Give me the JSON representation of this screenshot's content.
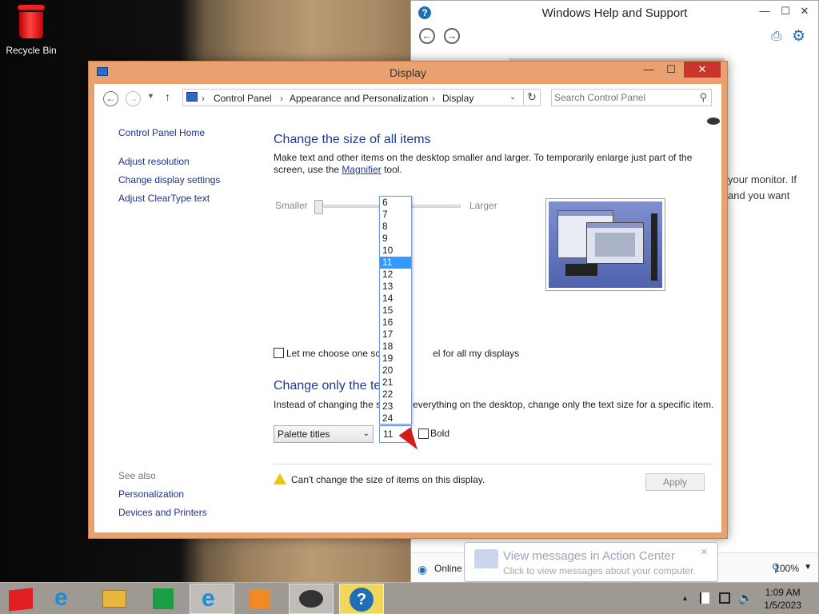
{
  "desktop": {
    "recycle_bin_label": "Recycle Bin"
  },
  "help_window": {
    "title": "Windows Help and Support",
    "body_text_line1": "your monitor. If",
    "body_text_line2": "and you want",
    "online_help_label": "Online Help",
    "zoom_label": "100%"
  },
  "display_window": {
    "title": "Display",
    "breadcrumb": [
      "Control Panel",
      "Appearance and Personalization",
      "Display"
    ],
    "search_placeholder": "Search Control Panel",
    "sidebar": {
      "home": "Control Panel Home",
      "links": [
        "Adjust resolution",
        "Change display settings",
        "Adjust ClearType text"
      ],
      "see_also_header": "See also",
      "see_also_links": [
        "Personalization",
        "Devices and Printers"
      ]
    },
    "section1": {
      "heading": "Change the size of all items",
      "desc_part1": "Make text and other items on the desktop smaller and larger. To temporarily enlarge just part of the screen, use the ",
      "magnifier_link": "Magnifier",
      "desc_part2": " tool.",
      "slider_min_label": "Smaller",
      "slider_max_label": "Larger",
      "checkbox_label_part1": "Let me choose one sca",
      "checkbox_label_part2": "el for all my displays"
    },
    "section2": {
      "heading": "Change only the tex",
      "desc_part1": "Instead of changing the s",
      "desc_part2": "everything on the desktop, change only the text size for a specific item.",
      "item_select": "Palette titles",
      "size_select": "11",
      "bold_label": "Bold"
    },
    "font_size_options": [
      "6",
      "7",
      "8",
      "9",
      "10",
      "11",
      "12",
      "13",
      "14",
      "15",
      "16",
      "17",
      "18",
      "19",
      "20",
      "21",
      "22",
      "23",
      "24"
    ],
    "font_size_selected": "11",
    "warning_text": "Can't change the size of items on this display.",
    "apply_label": "Apply"
  },
  "notification": {
    "title": "View messages in Action Center",
    "body": "Click to view messages about your computer."
  },
  "taskbar": {
    "time": "1:09 AM",
    "date": "1/5/2023"
  }
}
